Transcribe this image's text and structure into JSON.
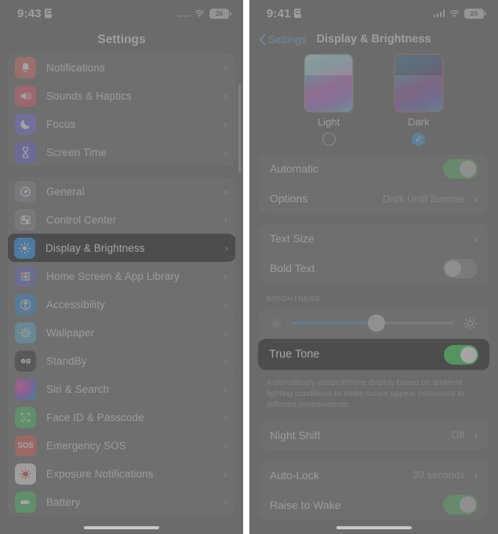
{
  "left_phone": {
    "status_bar": {
      "time": "9:43",
      "lock_icon": "lock-portrait-icon",
      "signal_icon": "cellular-dots-icon",
      "wifi_icon": "wifi-icon",
      "battery_level": "26"
    },
    "title": "Settings",
    "groups": [
      {
        "items": [
          {
            "label": "Notifications",
            "icon": "bell-icon",
            "color": "#e8736a"
          },
          {
            "label": "Sounds & Haptics",
            "icon": "speaker-icon",
            "color": "#ec5f7a"
          },
          {
            "label": "Focus",
            "icon": "moon-icon",
            "color": "#7b73e8"
          },
          {
            "label": "Screen Time",
            "icon": "hourglass-icon",
            "color": "#6d68e0"
          }
        ]
      },
      {
        "items": [
          {
            "label": "General",
            "icon": "gear-icon",
            "color": "#8e8e93"
          },
          {
            "label": "Control Center",
            "icon": "sliders-icon",
            "color": "#8e8e93"
          },
          {
            "label": "Display & Brightness",
            "icon": "brightness-icon",
            "color": "#1f8ff5",
            "selected": true
          },
          {
            "label": "Home Screen & App Library",
            "icon": "app-grid-icon",
            "color": "#6f72c9"
          },
          {
            "label": "Accessibility",
            "icon": "accessibility-icon",
            "color": "#3b8fd8"
          },
          {
            "label": "Wallpaper",
            "icon": "wallpaper-icon",
            "color": "#5fb6d6"
          },
          {
            "label": "StandBy",
            "icon": "standby-icon",
            "color": "#3c3c3e"
          },
          {
            "label": "Siri & Search",
            "icon": "siri-icon",
            "color": "#9b59b6"
          },
          {
            "label": "Face ID & Passcode",
            "icon": "face-id-icon",
            "color": "#4cc96a"
          },
          {
            "label": "Emergency SOS",
            "icon": "sos-icon",
            "color": "#e8625c"
          },
          {
            "label": "Exposure Notifications",
            "icon": "exposure-icon",
            "color": "#f0f0f0"
          },
          {
            "label": "Battery",
            "icon": "battery-icon",
            "color": "#4cc96a"
          }
        ]
      }
    ]
  },
  "right_phone": {
    "status_bar": {
      "time": "9:41",
      "lock_icon": "lock-portrait-icon",
      "signal_icon": "cellular-bars-icon",
      "wifi_icon": "wifi-icon",
      "battery_level": "26"
    },
    "nav": {
      "back_label": "Settings",
      "back_icon": "chevron-left-icon",
      "title": "Display & Brightness"
    },
    "appearance": {
      "options": [
        {
          "name": "Light",
          "selected": false
        },
        {
          "name": "Dark",
          "selected": true,
          "check_icon": "checkmark-icon"
        }
      ]
    },
    "appearance_rows": [
      {
        "label": "Automatic",
        "type": "toggle",
        "on": true
      },
      {
        "label": "Options",
        "type": "value",
        "value": "Dark Until Sunrise",
        "chevron": "chevron-right-icon"
      }
    ],
    "text_rows": [
      {
        "label": "Text Size",
        "type": "link",
        "chevron": "chevron-right-icon"
      },
      {
        "label": "Bold Text",
        "type": "toggle",
        "on": false
      }
    ],
    "brightness": {
      "section_header": "BRIGHTNESS",
      "slider": {
        "value_percent": 52,
        "low_icon": "sun-small-icon",
        "high_icon": "sun-large-icon"
      },
      "true_tone": {
        "label": "True Tone",
        "on": true,
        "highlighted": true
      },
      "description": "Automatically adapt iPhone display based on ambient lighting conditions to make colors appear consistent in different environments."
    },
    "night_shift": {
      "label": "Night Shift",
      "value": "Off",
      "chevron": "chevron-right-icon"
    },
    "lock_rows": [
      {
        "label": "Auto-Lock",
        "type": "value",
        "value": "30 seconds",
        "chevron": "chevron-right-icon"
      },
      {
        "label": "Raise to Wake",
        "type": "toggle",
        "on": true
      }
    ]
  },
  "colors": {
    "accent_blue": "#1f8ff5",
    "toggle_green": "#2bd44a",
    "highlight_bg": "#1c1c1e",
    "dim_overlay": "#6c6c6c"
  }
}
